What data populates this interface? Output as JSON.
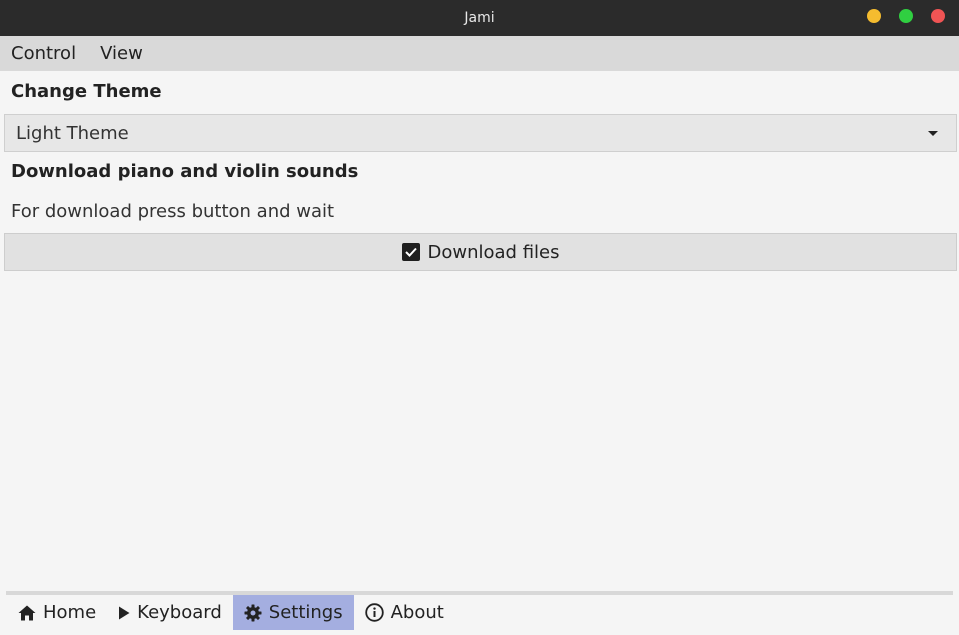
{
  "window": {
    "title": "Jami"
  },
  "menubar": {
    "items": [
      "Control",
      "View"
    ]
  },
  "settings": {
    "theme_heading": "Change Theme",
    "theme_selected": "Light Theme",
    "download_heading": "Download piano and violin sounds",
    "download_hint": "For download press button and wait",
    "download_button": "Download files",
    "download_checked": true
  },
  "tabs": [
    {
      "label": "Home",
      "icon": "home-icon",
      "active": false
    },
    {
      "label": "Keyboard",
      "icon": "play-icon",
      "active": false
    },
    {
      "label": "Settings",
      "icon": "gear-icon",
      "active": true
    },
    {
      "label": "About",
      "icon": "info-icon",
      "active": false
    }
  ],
  "colors": {
    "titlebar": "#2b2b2b",
    "active_tab": "#a4aee0",
    "minimize": "#f5bc2f",
    "maximize": "#30cf41",
    "close": "#f05454"
  }
}
